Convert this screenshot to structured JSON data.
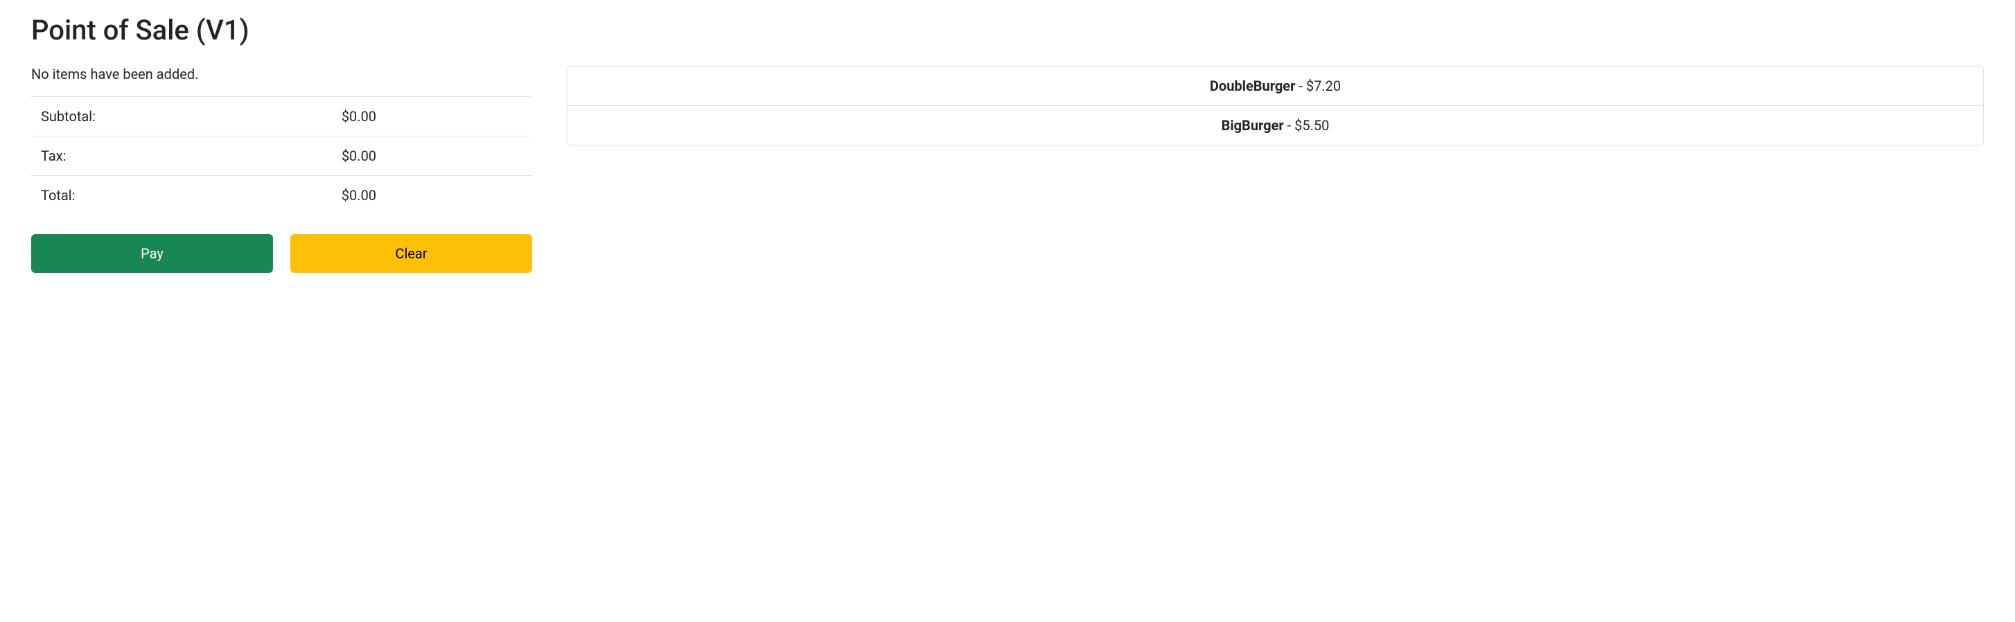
{
  "title": "Point of Sale (V1)",
  "cart": {
    "empty_message": "No items have been added.",
    "rows": [
      {
        "label": "Subtotal:",
        "value": "$0.00"
      },
      {
        "label": "Tax:",
        "value": "$0.00"
      },
      {
        "label": "Total:",
        "value": "$0.00"
      }
    ]
  },
  "buttons": {
    "pay": "Pay",
    "clear": "Clear"
  },
  "products": [
    {
      "name": "DoubleBurger",
      "price": "$7.20",
      "sep": " - "
    },
    {
      "name": "BigBurger",
      "price": "$5.50",
      "sep": " - "
    }
  ]
}
